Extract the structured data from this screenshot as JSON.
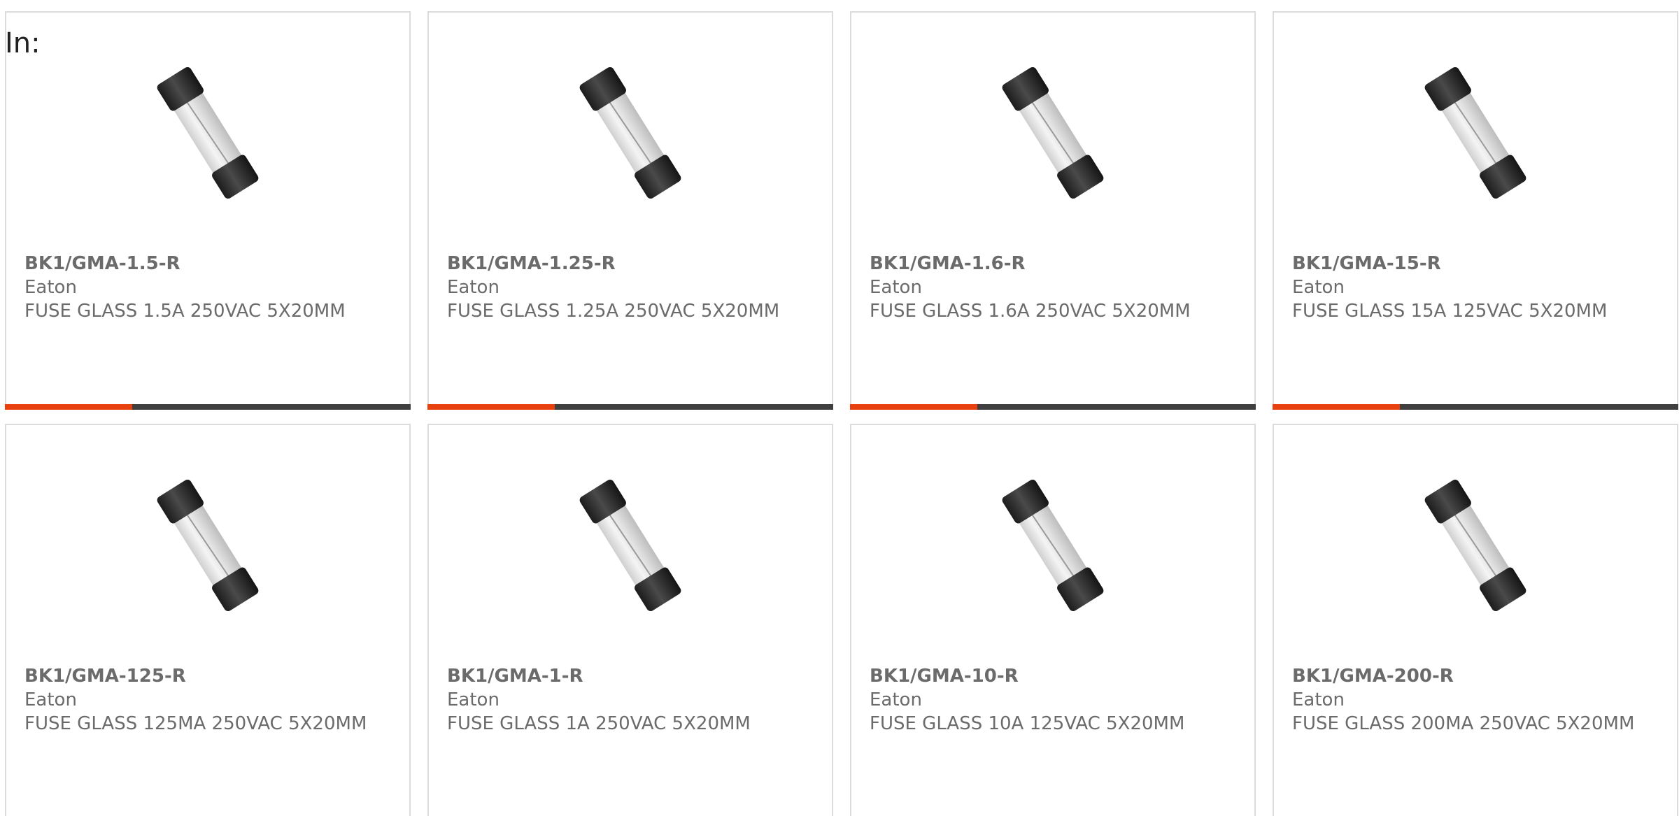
{
  "header": {
    "in_label": "In:"
  },
  "colors": {
    "accent": "#e8400e",
    "bar": "#3f3f3f",
    "text": "#6b6b6b",
    "border": "#dcdcdc"
  },
  "products": [
    {
      "part_number": "BK1/GMA-1.5-R",
      "manufacturer": "Eaton",
      "description": "FUSE GLASS 1.5A 250VAC 5X20MM",
      "image_icon": "glass-fuse-icon"
    },
    {
      "part_number": "BK1/GMA-1.25-R",
      "manufacturer": "Eaton",
      "description": "FUSE GLASS 1.25A 250VAC 5X20MM",
      "image_icon": "glass-fuse-icon"
    },
    {
      "part_number": "BK1/GMA-1.6-R",
      "manufacturer": "Eaton",
      "description": "FUSE GLASS 1.6A 250VAC 5X20MM",
      "image_icon": "glass-fuse-icon"
    },
    {
      "part_number": "BK1/GMA-15-R",
      "manufacturer": "Eaton",
      "description": "FUSE GLASS 15A 125VAC 5X20MM",
      "image_icon": "glass-fuse-icon"
    },
    {
      "part_number": "BK1/GMA-125-R",
      "manufacturer": "Eaton",
      "description": "FUSE GLASS 125MA 250VAC 5X20MM",
      "image_icon": "glass-fuse-icon"
    },
    {
      "part_number": "BK1/GMA-1-R",
      "manufacturer": "Eaton",
      "description": "FUSE GLASS 1A 250VAC 5X20MM",
      "image_icon": "glass-fuse-icon"
    },
    {
      "part_number": "BK1/GMA-10-R",
      "manufacturer": "Eaton",
      "description": "FUSE GLASS 10A 125VAC 5X20MM",
      "image_icon": "glass-fuse-icon"
    },
    {
      "part_number": "BK1/GMA-200-R",
      "manufacturer": "Eaton",
      "description": "FUSE GLASS 200MA 250VAC 5X20MM",
      "image_icon": "glass-fuse-icon"
    }
  ]
}
